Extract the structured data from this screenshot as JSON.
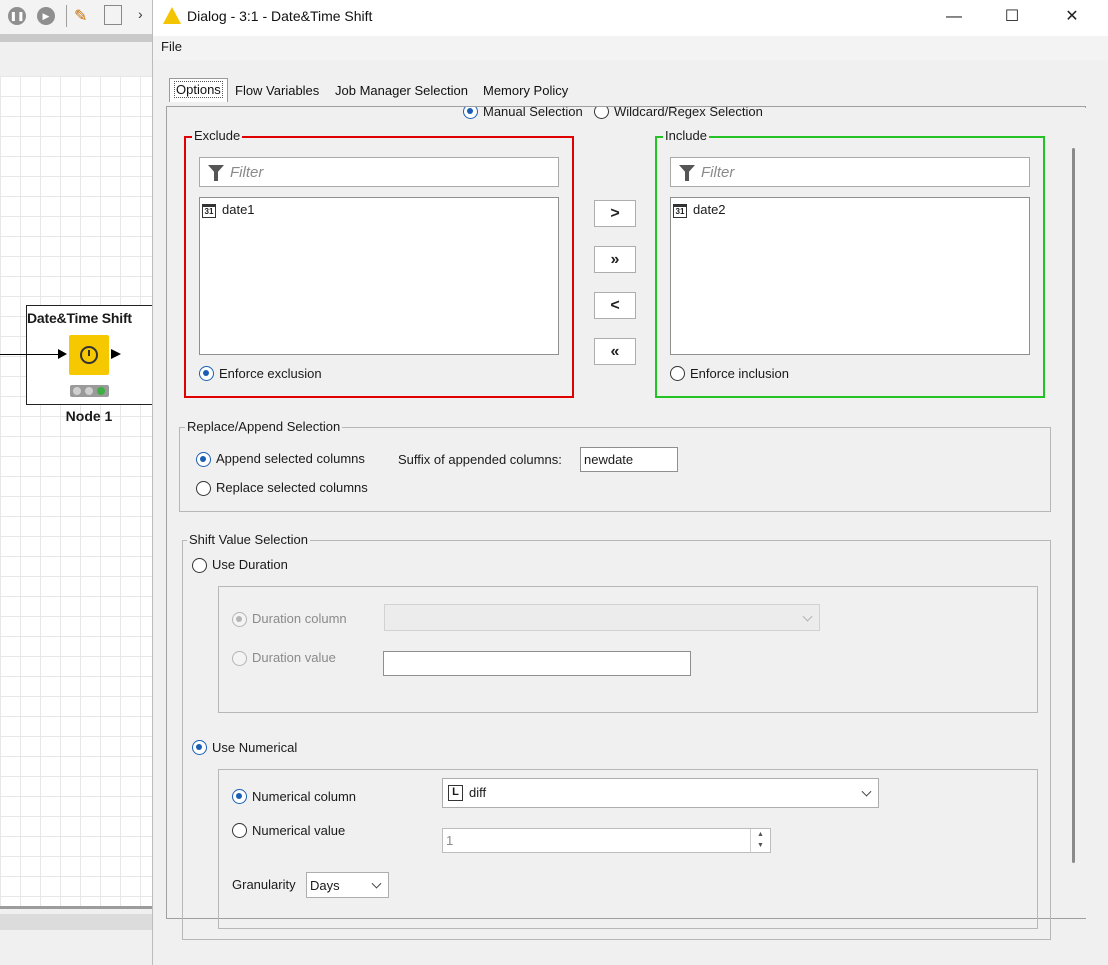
{
  "background": {
    "toolbar_icons": [
      "pause-icon",
      "play-step-icon",
      "wrench-icon",
      "layout-icon",
      "chevron-right-icon"
    ],
    "node": {
      "title": "Date&Time Shift",
      "label": "Node 1",
      "status_colors": [
        "#c8c8c8",
        "#c8c8c8",
        "#3cb043"
      ]
    }
  },
  "dialog": {
    "title": "Dialog - 3:1 - Date&Time Shift",
    "menu": {
      "file": "File"
    },
    "window_controls": {
      "minimize": "—",
      "maximize": "☐",
      "close": "✕"
    },
    "tabs": [
      "Options",
      "Flow Variables",
      "Job Manager Selection",
      "Memory Policy"
    ],
    "active_tab": "Options",
    "selection_mode": {
      "manual": "Manual Selection",
      "wildcard": "Wildcard/Regex Selection",
      "selected": "manual"
    },
    "exclude": {
      "legend": "Exclude",
      "filter_placeholder": "Filter",
      "items": [
        "date1"
      ],
      "enforce_label": "Enforce exclusion",
      "color": "#e00000"
    },
    "include": {
      "legend": "Include",
      "filter_placeholder": "Filter",
      "items": [
        "date2"
      ],
      "enforce_label": "Enforce inclusion",
      "color": "#22c322"
    },
    "move_buttons": [
      ">",
      "»",
      "<",
      "«"
    ],
    "replace_append": {
      "legend": "Replace/Append Selection",
      "append_label": "Append selected columns",
      "replace_label": "Replace selected columns",
      "suffix_label": "Suffix of appended columns:",
      "suffix_value": "newdate"
    },
    "shift_value": {
      "legend": "Shift Value Selection",
      "use_duration": "Use Duration",
      "duration_column": "Duration column",
      "duration_value": "Duration value",
      "use_numerical": "Use Numerical",
      "numerical_column": "Numerical column",
      "numerical_column_value": "diff",
      "numerical_value": "Numerical value",
      "numerical_value_value": "1",
      "granularity_label": "Granularity",
      "granularity_value": "Days"
    }
  }
}
